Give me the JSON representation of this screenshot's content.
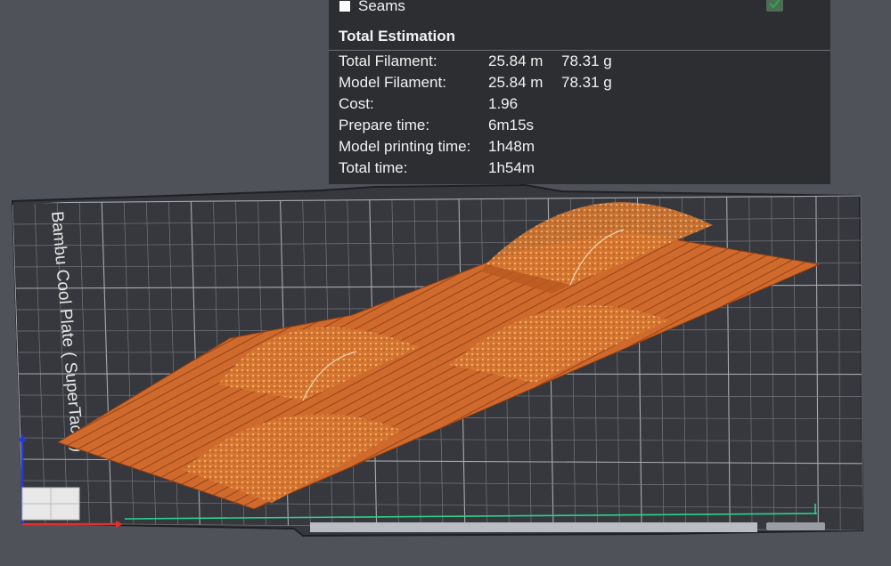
{
  "plate": {
    "label": "Bambu Cool Plate ( SuperTack )"
  },
  "stats_panel": {
    "seams_label": "Seams",
    "section_title": "Total Estimation",
    "rows": [
      {
        "label": "Total Filament:",
        "value1": "25.84 m",
        "value2": "78.31 g"
      },
      {
        "label": "Model Filament:",
        "value1": "25.84 m",
        "value2": "78.31 g"
      },
      {
        "label": "Cost:",
        "value1": "1.96",
        "value2": ""
      },
      {
        "label": "Prepare time:",
        "value1": "6m15s",
        "value2": ""
      },
      {
        "label": "Model printing time:",
        "value1": "1h48m",
        "value2": ""
      },
      {
        "label": "Total time:",
        "value1": "1h54m",
        "value2": ""
      }
    ]
  },
  "colors": {
    "background": "#50525a",
    "plate": "#36383d",
    "grid": "#8a8c92",
    "model": "#cf6a2c",
    "model_highlight": "#f08a3e",
    "panel": "#2d2e32",
    "check": "#2fa24f",
    "axis_x": "#e03030",
    "axis_y": "#2bd38a",
    "axis_z": "#2a3ad8"
  },
  "icons": {
    "seams_checkbox": "check-icon",
    "axis_gizmo": "axes-icon"
  }
}
